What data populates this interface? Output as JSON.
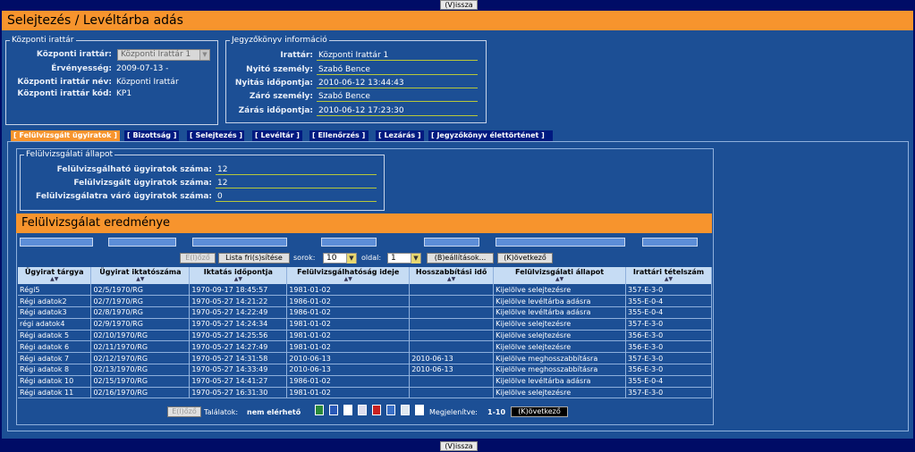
{
  "nav": {
    "back_label": "(V)issza"
  },
  "page": {
    "title": "Selejtezés / Levéltárba adás"
  },
  "kozponti": {
    "legend": "Központi irattár",
    "irattar_label": "Központi irattár:",
    "irattar_value": "Központi Irattár 1",
    "ervenyesseg_label": "Érvényesség:",
    "ervenyesseg_value": "2009-07-13 -",
    "nev_label": "Központi irattár név:",
    "nev_value": "Központi Irattár",
    "kod_label": "Központi irattár kód:",
    "kod_value": "KP1"
  },
  "jegyzokonyv": {
    "legend": "Jegyzőkönyv információ",
    "rows": [
      {
        "label": "Irattár:",
        "value": "Központi Irattár 1"
      },
      {
        "label": "Nyitó személy:",
        "value": "Szabó Bence"
      },
      {
        "label": "Nyitás időpontja:",
        "value": "2010-06-12 13:44:43"
      },
      {
        "label": "Záró személy:",
        "value": "Szabó Bence"
      },
      {
        "label": "Zárás időpontja:",
        "value": "2010-06-12 17:23:30"
      }
    ]
  },
  "tabs": [
    {
      "label": "[ Felülvizsgált ügyiratok ]",
      "active": true
    },
    {
      "label": "[ Bizottság ]"
    },
    {
      "label": "[ Selejtezés ]"
    },
    {
      "label": "[ Levéltár ]"
    },
    {
      "label": "[ Ellenőrzés ]"
    },
    {
      "label": "[ Lezárás ]"
    },
    {
      "label": "[ Jegyzőkönyv élettörténet ]"
    }
  ],
  "allapot": {
    "legend": "Felülvizsgálati állapot",
    "rows": [
      {
        "label": "Felülvizsgálható ügyiratok száma:",
        "value": "12"
      },
      {
        "label": "Felülvizsgált ügyiratok száma:",
        "value": "12"
      },
      {
        "label": "Felülvizsgálatra váró ügyiratok száma:",
        "value": "0"
      }
    ]
  },
  "result": {
    "title": "Felülvizsgálat eredménye",
    "prev_label": "E(l)őző",
    "refresh_label": "Lista fri(s)sítése",
    "rows_label": "sorok:",
    "rows_value": "10",
    "page_label": "oldal:",
    "page_value": "1",
    "settings_label": "(B)eállítások...",
    "next_label": "(K)övetkező",
    "columns": [
      "Ügyirat tárgya",
      "Ügyirat iktatószáma",
      "Iktatás időpontja",
      "Felülvizsgálhatóság ideje",
      "Hosszabbítási idő",
      "Felülvizsgálati állapot",
      "Irattári tételszám"
    ],
    "rows": [
      [
        "Régi5",
        "02/5/1970/RG",
        "1970-09-17 18:45:57",
        "1981-01-02",
        "",
        "Kijelölve selejtezésre",
        "357-E-3-0"
      ],
      [
        "Régi adatok2",
        "02/7/1970/RG",
        "1970-05-27 14:21:22",
        "1986-01-02",
        "",
        "Kijelölve levéltárba adásra",
        "355-E-0-4"
      ],
      [
        "Régi adatok3",
        "02/8/1970/RG",
        "1970-05-27 14:22:49",
        "1986-01-02",
        "",
        "Kijelölve levéltárba adásra",
        "355-E-0-4"
      ],
      [
        "régi adatok4",
        "02/9/1970/RG",
        "1970-05-27 14:24:34",
        "1981-01-02",
        "",
        "Kijelölve selejtezésre",
        "357-E-3-0"
      ],
      [
        "Régi adatok 5",
        "02/10/1970/RG",
        "1970-05-27 14:25:56",
        "1981-01-02",
        "",
        "Kijelölve selejtezésre",
        "356-E-3-0"
      ],
      [
        "Régi adatok 6",
        "02/11/1970/RG",
        "1970-05-27 14:27:49",
        "1981-01-02",
        "",
        "Kijelölve selejtezésre",
        "356-E-3-0"
      ],
      [
        "Régi adatok 7",
        "02/12/1970/RG",
        "1970-05-27 14:31:58",
        "2010-06-13",
        "2010-06-13",
        "Kijelölve meghosszabbításra",
        "357-E-3-0"
      ],
      [
        "Régi adatok 8",
        "02/13/1970/RG",
        "1970-05-27 14:33:49",
        "2010-06-13",
        "2010-06-13",
        "Kijelölve meghosszabbításra",
        "356-E-3-0"
      ],
      [
        "Régi adatok 10",
        "02/15/1970/RG",
        "1970-05-27 14:41:27",
        "1986-01-02",
        "",
        "Kijelölve levéltárba adásra",
        "355-E-0-4"
      ],
      [
        "Régi adatok 11",
        "02/16/1970/RG",
        "1970-05-27 16:31:30",
        "1981-01-02",
        "",
        "Kijelölve selejtezésre",
        "357-E-3-0"
      ]
    ],
    "footer": {
      "prev_label": "E(l)őző",
      "results_label": "Találatok:",
      "results_value": "nem elérhető",
      "display_label": "Megjelenítve:",
      "display_value": "1-10",
      "next_label": "(K)övetkező"
    }
  },
  "colors": {
    "accent": "#f7942d",
    "panel": "#1c4f95",
    "background": "#000c66",
    "header": "#c6dcf4"
  }
}
